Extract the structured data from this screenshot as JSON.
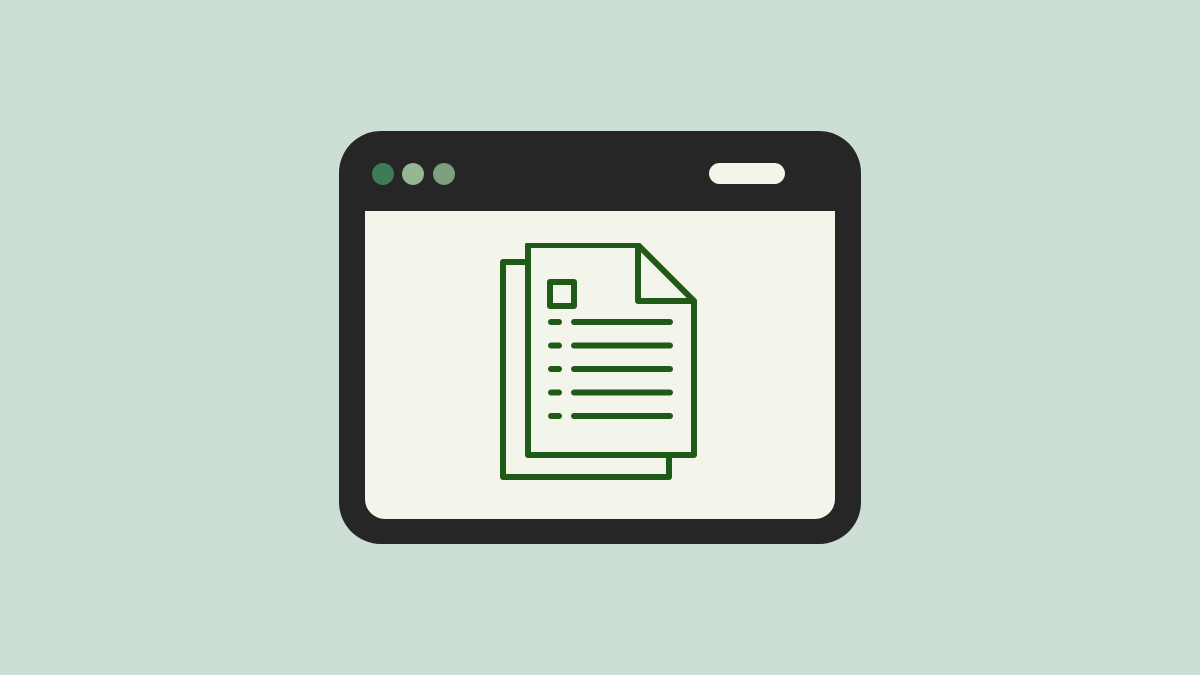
{
  "colors": {
    "background": "#cddfd4",
    "window_frame": "#262626",
    "content_bg": "#f4f5ea",
    "dot_1": "#3f7b57",
    "dot_2": "#95b791",
    "dot_3": "#7e9f7d",
    "pill": "#f4f5ea",
    "icon_stroke": "#1f5a17"
  },
  "icons": {
    "window_controls": [
      "window-dot-icon",
      "window-dot-icon",
      "window-dot-icon"
    ],
    "address_bar": "pill-icon",
    "main": "documents-icon"
  },
  "document": {
    "line_count": 5
  }
}
